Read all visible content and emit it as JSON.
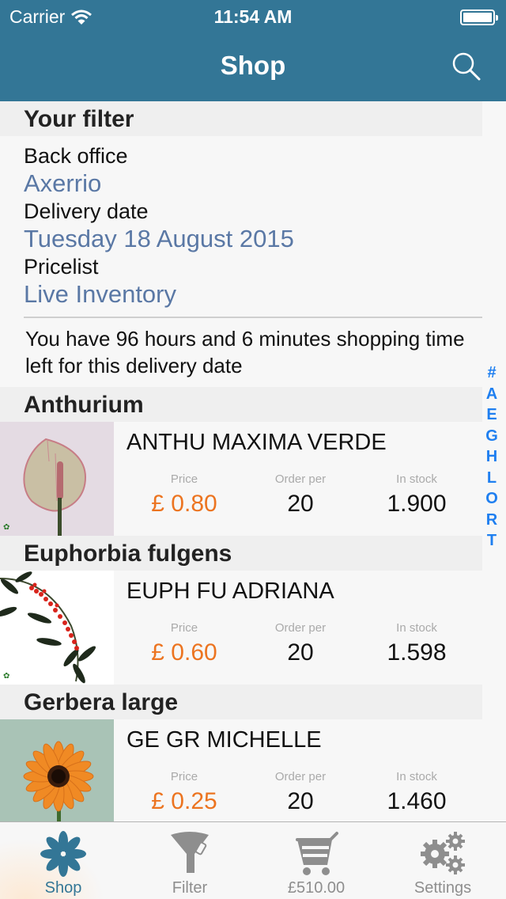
{
  "status_bar": {
    "carrier": "Carrier",
    "time": "11:54 AM",
    "battery_level": 1.0
  },
  "nav": {
    "title": "Shop",
    "search_icon": "search-icon"
  },
  "filter": {
    "header": "Your filter",
    "fields": [
      {
        "label": "Back office",
        "value": "Axerrio"
      },
      {
        "label": "Delivery date",
        "value": "Tuesday 18 August 2015"
      },
      {
        "label": "Pricelist",
        "value": "Live Inventory"
      }
    ],
    "notice": "You have 96 hours and 6 minutes shopping time left for this delivery date"
  },
  "colors": {
    "brand": "#337696",
    "price": "#ec7420",
    "link": "#5a78a5",
    "index": "#1f7ff0"
  },
  "stat_labels": {
    "price": "Price",
    "order_per": "Order per",
    "in_stock": "In stock"
  },
  "sections": [
    {
      "title": "Anthurium",
      "product": {
        "name": "ANTHU MAXIMA VERDE",
        "price": "£ 0.80",
        "order_per": "20",
        "in_stock": "1.900",
        "image": "anthurium-photo"
      }
    },
    {
      "title": "Euphorbia fulgens",
      "product": {
        "name": "EUPH FU ADRIANA",
        "price": "£ 0.60",
        "order_per": "20",
        "in_stock": "1.598",
        "image": "euphorbia-photo"
      }
    },
    {
      "title": "Gerbera large",
      "product": {
        "name": "GE GR MICHELLE",
        "price": "£ 0.25",
        "order_per": "20",
        "in_stock": "1.460",
        "image": "gerbera-photo"
      }
    }
  ],
  "section_index": [
    "#",
    "A",
    "E",
    "G",
    "H",
    "L",
    "O",
    "R",
    "T"
  ],
  "tabs": [
    {
      "label": "Shop",
      "icon": "flower-icon",
      "active": true
    },
    {
      "label": "Filter",
      "icon": "funnel-icon",
      "active": false
    },
    {
      "label": "£510.00",
      "icon": "cart-icon",
      "active": false
    },
    {
      "label": "Settings",
      "icon": "gears-icon",
      "active": false
    }
  ]
}
